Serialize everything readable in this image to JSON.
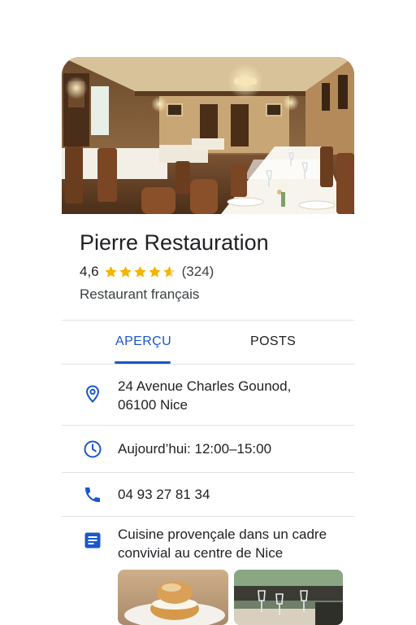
{
  "place": {
    "name": "Pierre Restauration",
    "rating": "4,6",
    "rating_value": 4.6,
    "stars_total": 5,
    "review_count": "(324)",
    "category": "Restaurant français"
  },
  "tabs": [
    {
      "label": "APERÇU",
      "active": true
    },
    {
      "label": "POSTS",
      "active": false
    }
  ],
  "info": {
    "address_line1": "24 Avenue Charles Gounod,",
    "address_line2": "06100 Nice",
    "hours": "Aujourd’hui: 12:00–15:00",
    "phone": "04 93 27 81 34",
    "description_line1": "Cuisine provençale dans un cadre",
    "description_line2": "convivial au centre de Nice"
  },
  "icons": {
    "address": "location-pin-icon",
    "hours": "clock-icon",
    "phone": "phone-icon",
    "description": "description-icon"
  },
  "colors": {
    "accent": "#1a57c9",
    "star": "#f4b400",
    "text": "#202124",
    "divider": "#e3e3e3"
  }
}
